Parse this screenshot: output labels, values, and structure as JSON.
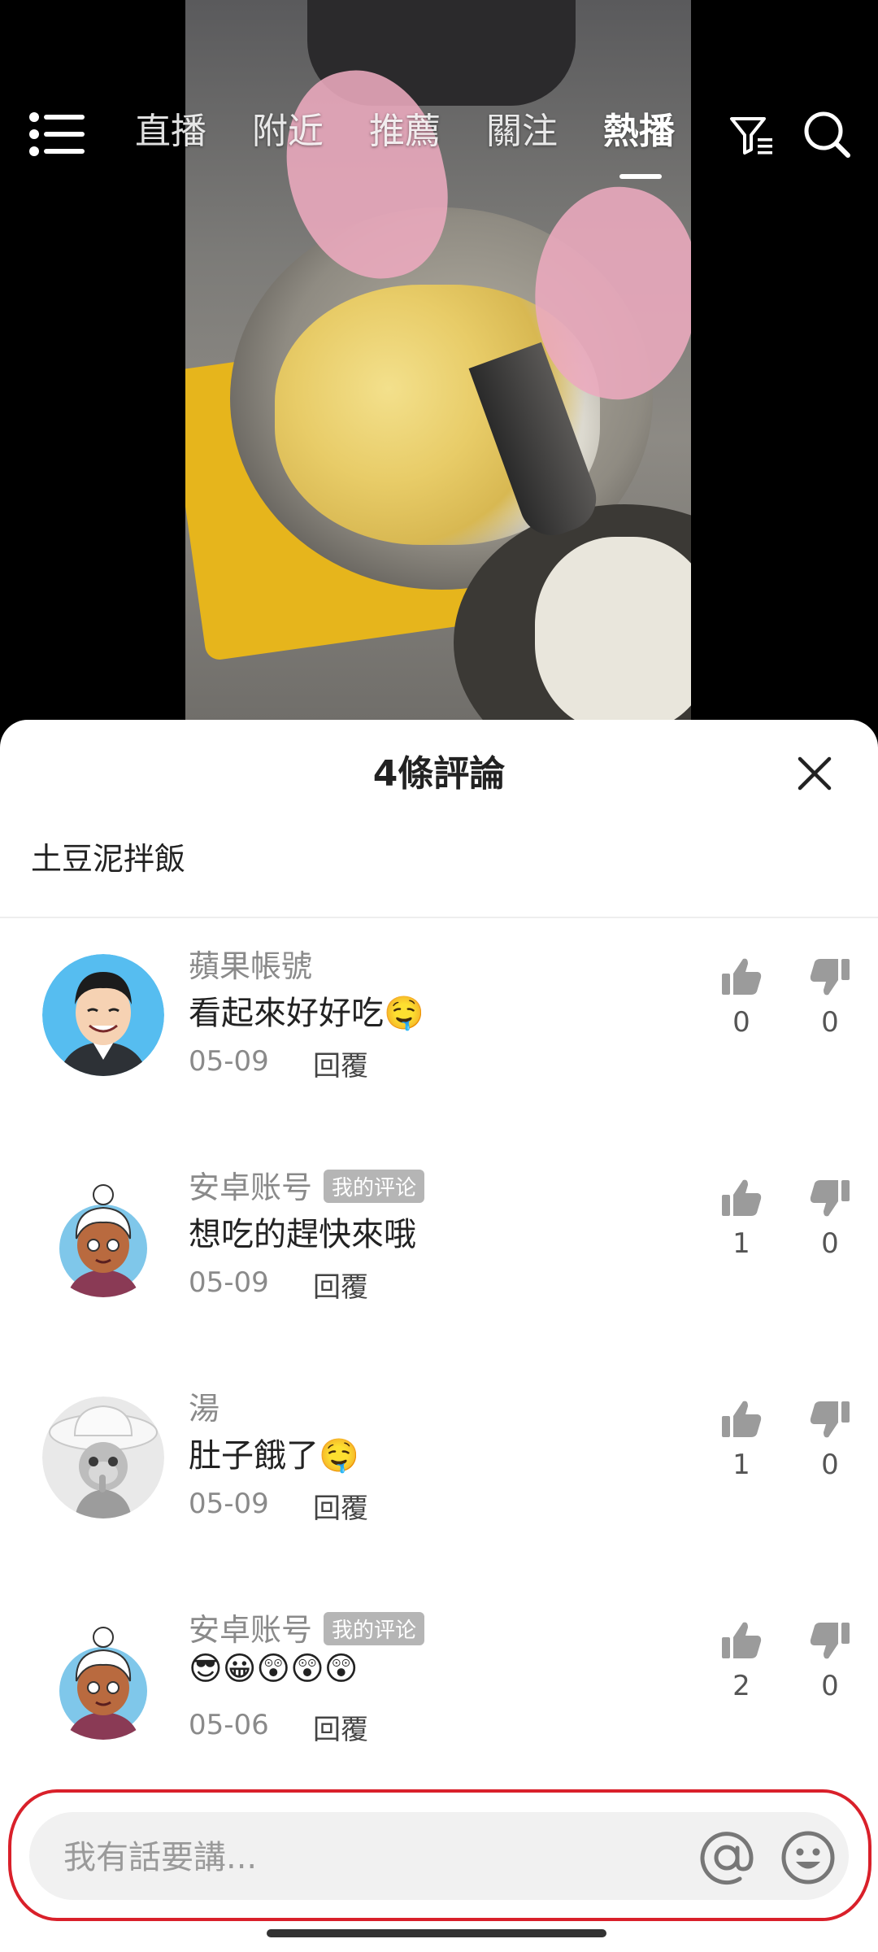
{
  "nav": {
    "tabs": [
      "直播",
      "附近",
      "推薦",
      "關注",
      "熱播"
    ],
    "active_tab": "熱播"
  },
  "comments_panel": {
    "title": "4條評論",
    "video_caption": "土豆泥拌飯",
    "close_icon": "close-icon",
    "items": [
      {
        "user": "蘋果帳號",
        "badge": "",
        "text": "看起來好好吃🤤",
        "date": "05-09",
        "reply": "回覆",
        "likes": "0",
        "dislikes": "0"
      },
      {
        "user": "安卓账号",
        "badge": "我的评论",
        "text": "想吃的趕快來哦",
        "date": "05-09",
        "reply": "回覆",
        "likes": "1",
        "dislikes": "0"
      },
      {
        "user": "湯",
        "badge": "",
        "text": "肚子餓了🤤",
        "date": "05-09",
        "reply": "回覆",
        "likes": "1",
        "dislikes": "0"
      },
      {
        "user": "安卓账号",
        "badge": "我的评论",
        "text": "😎😀😲😲😲",
        "date": "05-06",
        "reply": "回覆",
        "likes": "2",
        "dislikes": "0"
      }
    ]
  },
  "input": {
    "placeholder": "我有話要講..."
  },
  "colors": {
    "highlight_border": "#d9202a",
    "sheet_bg": "#ffffff",
    "icon_gray": "#9b9b9b"
  }
}
